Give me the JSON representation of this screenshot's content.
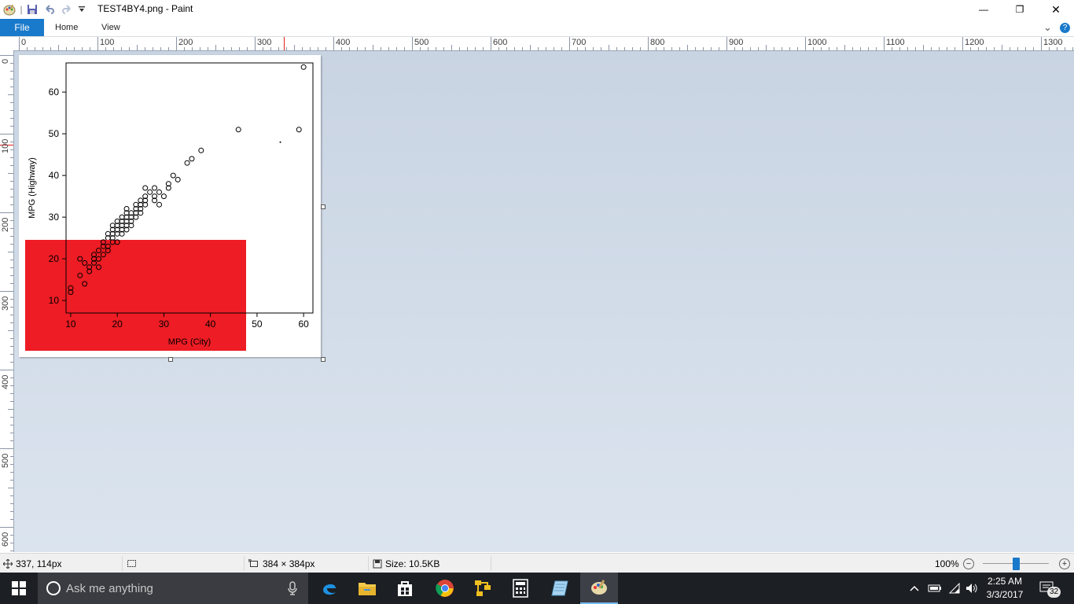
{
  "window": {
    "title": "TEST4BY4.png - Paint",
    "minimize_label": "—",
    "maximize_label": "❐",
    "close_label": "✕"
  },
  "ribbon": {
    "tabs": [
      "File",
      "Home",
      "View"
    ],
    "collapse_label": "⌄",
    "help_label": "?"
  },
  "rulers": {
    "top_labels": [
      "0",
      "100",
      "200",
      "300",
      "400",
      "500",
      "600",
      "700",
      "800",
      "900",
      "1000",
      "1100",
      "1200",
      "1300"
    ],
    "left_labels": [
      "0",
      "100",
      "200",
      "300",
      "400",
      "500",
      "600"
    ]
  },
  "image": {
    "x_label": "MPG (City)",
    "y_label": "MPG (Highway)",
    "x_ticks": [
      "10",
      "20",
      "30",
      "40",
      "50",
      "60"
    ],
    "y_ticks": [
      "10",
      "20",
      "30",
      "40",
      "50",
      "60"
    ],
    "red_color": "#ee1c24"
  },
  "chart_data": {
    "type": "scatter",
    "xlabel": "MPG (City)",
    "ylabel": "MPG (Highway)",
    "xlim": [
      9,
      62
    ],
    "ylim": [
      7,
      67
    ],
    "x_ticks": [
      10,
      20,
      30,
      40,
      50,
      60
    ],
    "y_ticks": [
      10,
      20,
      30,
      40,
      50,
      60
    ],
    "points": [
      [
        10,
        12
      ],
      [
        10,
        13
      ],
      [
        12,
        16
      ],
      [
        12,
        20
      ],
      [
        13,
        19
      ],
      [
        13,
        14
      ],
      [
        14,
        17
      ],
      [
        14,
        18
      ],
      [
        15,
        20
      ],
      [
        15,
        21
      ],
      [
        15,
        19
      ],
      [
        16,
        18
      ],
      [
        16,
        20
      ],
      [
        16,
        22
      ],
      [
        17,
        21
      ],
      [
        17,
        23
      ],
      [
        17,
        24
      ],
      [
        18,
        22
      ],
      [
        18,
        23
      ],
      [
        18,
        25
      ],
      [
        18,
        26
      ],
      [
        19,
        24
      ],
      [
        19,
        25
      ],
      [
        19,
        26
      ],
      [
        19,
        27
      ],
      [
        19,
        28
      ],
      [
        20,
        24
      ],
      [
        20,
        26
      ],
      [
        20,
        27
      ],
      [
        20,
        28
      ],
      [
        20,
        29
      ],
      [
        21,
        26
      ],
      [
        21,
        27
      ],
      [
        21,
        28
      ],
      [
        21,
        29
      ],
      [
        21,
        30
      ],
      [
        22,
        27
      ],
      [
        22,
        28
      ],
      [
        22,
        29
      ],
      [
        22,
        30
      ],
      [
        22,
        31
      ],
      [
        22,
        32
      ],
      [
        23,
        28
      ],
      [
        23,
        29
      ],
      [
        23,
        30
      ],
      [
        23,
        31
      ],
      [
        24,
        30
      ],
      [
        24,
        31
      ],
      [
        24,
        32
      ],
      [
        24,
        33
      ],
      [
        25,
        31
      ],
      [
        25,
        32
      ],
      [
        25,
        33
      ],
      [
        25,
        34
      ],
      [
        26,
        33
      ],
      [
        26,
        34
      ],
      [
        26,
        35
      ],
      [
        26,
        37
      ],
      [
        27,
        36
      ],
      [
        28,
        34
      ],
      [
        28,
        35
      ],
      [
        28,
        37
      ],
      [
        29,
        33
      ],
      [
        29,
        36
      ],
      [
        30,
        35
      ],
      [
        31,
        37
      ],
      [
        31,
        38
      ],
      [
        32,
        40
      ],
      [
        33,
        39
      ],
      [
        35,
        43
      ],
      [
        36,
        44
      ],
      [
        38,
        46
      ],
      [
        46,
        51
      ],
      [
        59,
        51
      ],
      [
        60,
        66
      ]
    ],
    "small_points": [
      [
        55,
        48
      ]
    ],
    "grid": false
  },
  "status": {
    "cursor_pos": "337, 114px",
    "image_size": "384 × 384px",
    "file_size": "Size: 10.5KB",
    "zoom": "100%",
    "zoom_value": 100
  },
  "taskbar": {
    "search_placeholder": "Ask me anything",
    "time": "2:25 AM",
    "date": "3/3/2017",
    "notifications": "32"
  }
}
